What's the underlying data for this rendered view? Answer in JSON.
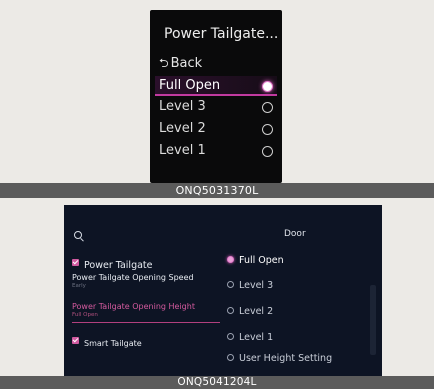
{
  "cluster": {
    "title": "Power Tailgate...",
    "back_label": "Back",
    "options": [
      {
        "label": "Full Open",
        "selected": true
      },
      {
        "label": "Level 3",
        "selected": false
      },
      {
        "label": "Level 2",
        "selected": false
      },
      {
        "label": "Level 1",
        "selected": false
      }
    ],
    "caption": "ONQ5031370L"
  },
  "infotainment": {
    "section_title": "Door",
    "left": {
      "power_tailgate": {
        "label": "Power Tailgate",
        "checked": true
      },
      "opening_speed": {
        "label": "Power Tailgate Opening Speed",
        "value": "Early"
      },
      "opening_height": {
        "label": "Power Tailgate Opening Height",
        "value": "Full Open"
      },
      "smart_tailgate": {
        "label": "Smart Tailgate",
        "checked": true
      }
    },
    "options": [
      {
        "label": "Full Open",
        "selected": true
      },
      {
        "label": "Level 3",
        "selected": false
      },
      {
        "label": "Level 2",
        "selected": false
      },
      {
        "label": "Level 1",
        "selected": false
      },
      {
        "label": "User Height Setting",
        "selected": false
      }
    ],
    "caption": "ONQ5041204L"
  },
  "icons": {
    "search": "search-icon",
    "back": "back-arrow-icon",
    "check": "checkbox-checked-icon"
  },
  "colors": {
    "accent": "#c23aa0",
    "screen_bg": "#0d1424",
    "cluster_bg": "#0a0a0b"
  }
}
